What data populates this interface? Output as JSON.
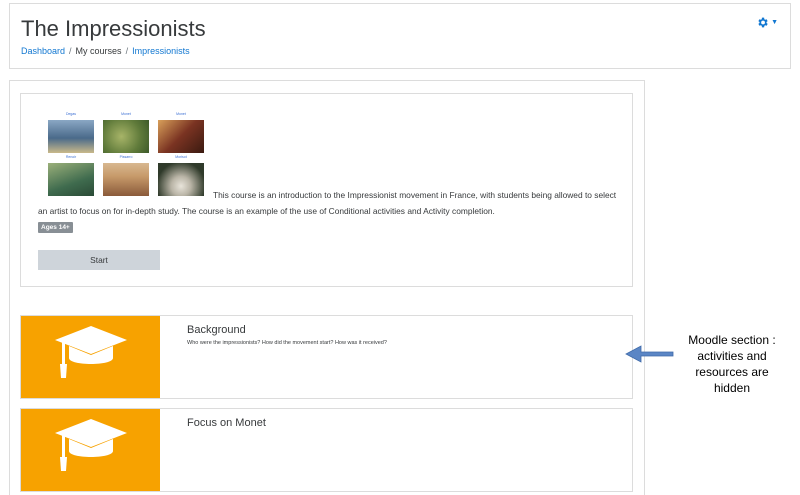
{
  "page": {
    "title": "The Impressionists",
    "breadcrumb": [
      "Dashboard",
      "My courses",
      "Impressionists"
    ],
    "settings_icon": "gear-icon",
    "settings_color": "#1177d1"
  },
  "summary": {
    "artworks": [
      {
        "caption": "Degas",
        "colors": [
          "#4a6a8a",
          "#c9b98a"
        ]
      },
      {
        "caption": "Monet",
        "colors": [
          "#5f7a3a",
          "#a7b468"
        ]
      },
      {
        "caption": "Monet",
        "colors": [
          "#7a3322",
          "#d9a05a"
        ]
      },
      {
        "caption": "Renoir",
        "colors": [
          "#3f6b4e",
          "#9bb07a"
        ]
      },
      {
        "caption": "Pissarro",
        "colors": [
          "#8a5a3a",
          "#c79a6a"
        ]
      },
      {
        "caption": "Morisot",
        "colors": [
          "#2f3a2a",
          "#e8e4da"
        ]
      }
    ],
    "description": "This course is an introduction to the Impressionist movement in France, with students being allowed to select an artist to focus on for in-depth study. The course is an example of the use of Conditional activities and Activity completion.",
    "badge": "Ages 14+",
    "start_label": "Start"
  },
  "sections": [
    {
      "title": "Background",
      "summary": "Who were the impressionists?  How did the movement start? How was it received?",
      "icon": "graduation-cap-icon"
    },
    {
      "title": "Focus on Monet",
      "summary": "",
      "icon": "graduation-cap-icon"
    }
  ],
  "annotation": {
    "lines": [
      "Moodle section :",
      "activities and",
      "resources are",
      "hidden"
    ],
    "arrow_color": "#5b86c5"
  },
  "colors": {
    "accent": "#f7a200",
    "link": "#1177d1",
    "badge": "#888f95",
    "button": "#ced4da"
  }
}
